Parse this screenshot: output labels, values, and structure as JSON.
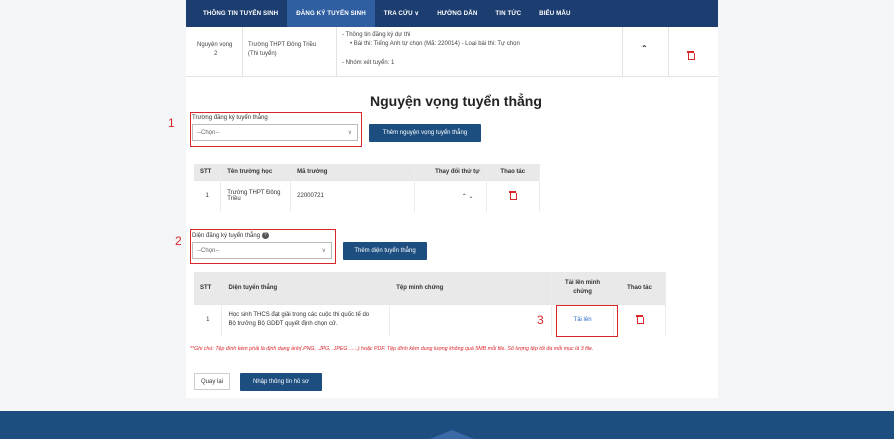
{
  "nav": {
    "items": [
      "THÔNG TIN TUYỂN SINH",
      "ĐĂNG KÝ TUYỂN SINH",
      "TRA CỨU ∨",
      "HƯỚNG DẪN",
      "TIN TỨC",
      "BIỂU MẪU"
    ],
    "active_index": 1
  },
  "nv_top": {
    "order_label": "Nguyện vọng",
    "order_num": "2",
    "school": "Trường THPT Đông Triều",
    "school_note": "(Thi tuyển)",
    "info_title": "- Thông tin đăng ký dự thi",
    "info_exam": "• Bài thi: Tiếng Anh tự chọn (Mã: 220014) - Loại bài thi: Tự chọn",
    "info_group": "- Nhóm xét tuyển: 1"
  },
  "title": "Nguyện vọng tuyển thẳng",
  "markers": {
    "m1": "1",
    "m2": "2",
    "m3": "3"
  },
  "school_select": {
    "label": "Trường đăng ký tuyển thẳng",
    "value": "--Chọn--",
    "button": "Thêm nguyện vọng tuyển thẳng"
  },
  "school_table": {
    "headers": [
      "STT",
      "Tên trường học",
      "Mã trường",
      "Thay đổi thứ tự",
      "Thao tác"
    ],
    "rows": [
      {
        "stt": "1",
        "name_line1": "Trường THPT Đông",
        "name_line2": "Triều",
        "code": "22000721",
        "order": "⌃  ⌄"
      }
    ]
  },
  "dien_select": {
    "label": "Diện đăng ký tuyển thẳng",
    "help": "?",
    "value": "--Chọn--",
    "button": "Thêm diện tuyển thẳng"
  },
  "dien_table": {
    "headers": [
      "STT",
      "Diện tuyển thẳng",
      "Tệp minh chứng",
      "Tải lên minh",
      "chứng",
      "Thao tác"
    ],
    "rows": [
      {
        "stt": "1",
        "line1": "Học sinh THCS đạt giải trong các cuộc thi quốc tế do",
        "line2": "Bộ trưởng Bộ GDĐT quyết định chọn cử.",
        "file": "",
        "upload": "Tải lên"
      }
    ]
  },
  "note": "**Ghi chú: Tệp đính kèm phải là định dạng ảnh(.PNG, .JPG, .JPEG ......) hoặc PDF. Tệp đính kèm dung lượng không quá 5MB mỗi file. Số lượng tệp tối đa mỗi mục là 3 file.",
  "buttons": {
    "back": "Quay lại",
    "submit": "Nhập thông tin hồ sơ"
  },
  "colors": {
    "nav": "#1c3d70",
    "nav_active": "#2f5fa0",
    "primary": "#1c4e80",
    "danger": "#d9262b",
    "link": "#2a6dc4"
  }
}
